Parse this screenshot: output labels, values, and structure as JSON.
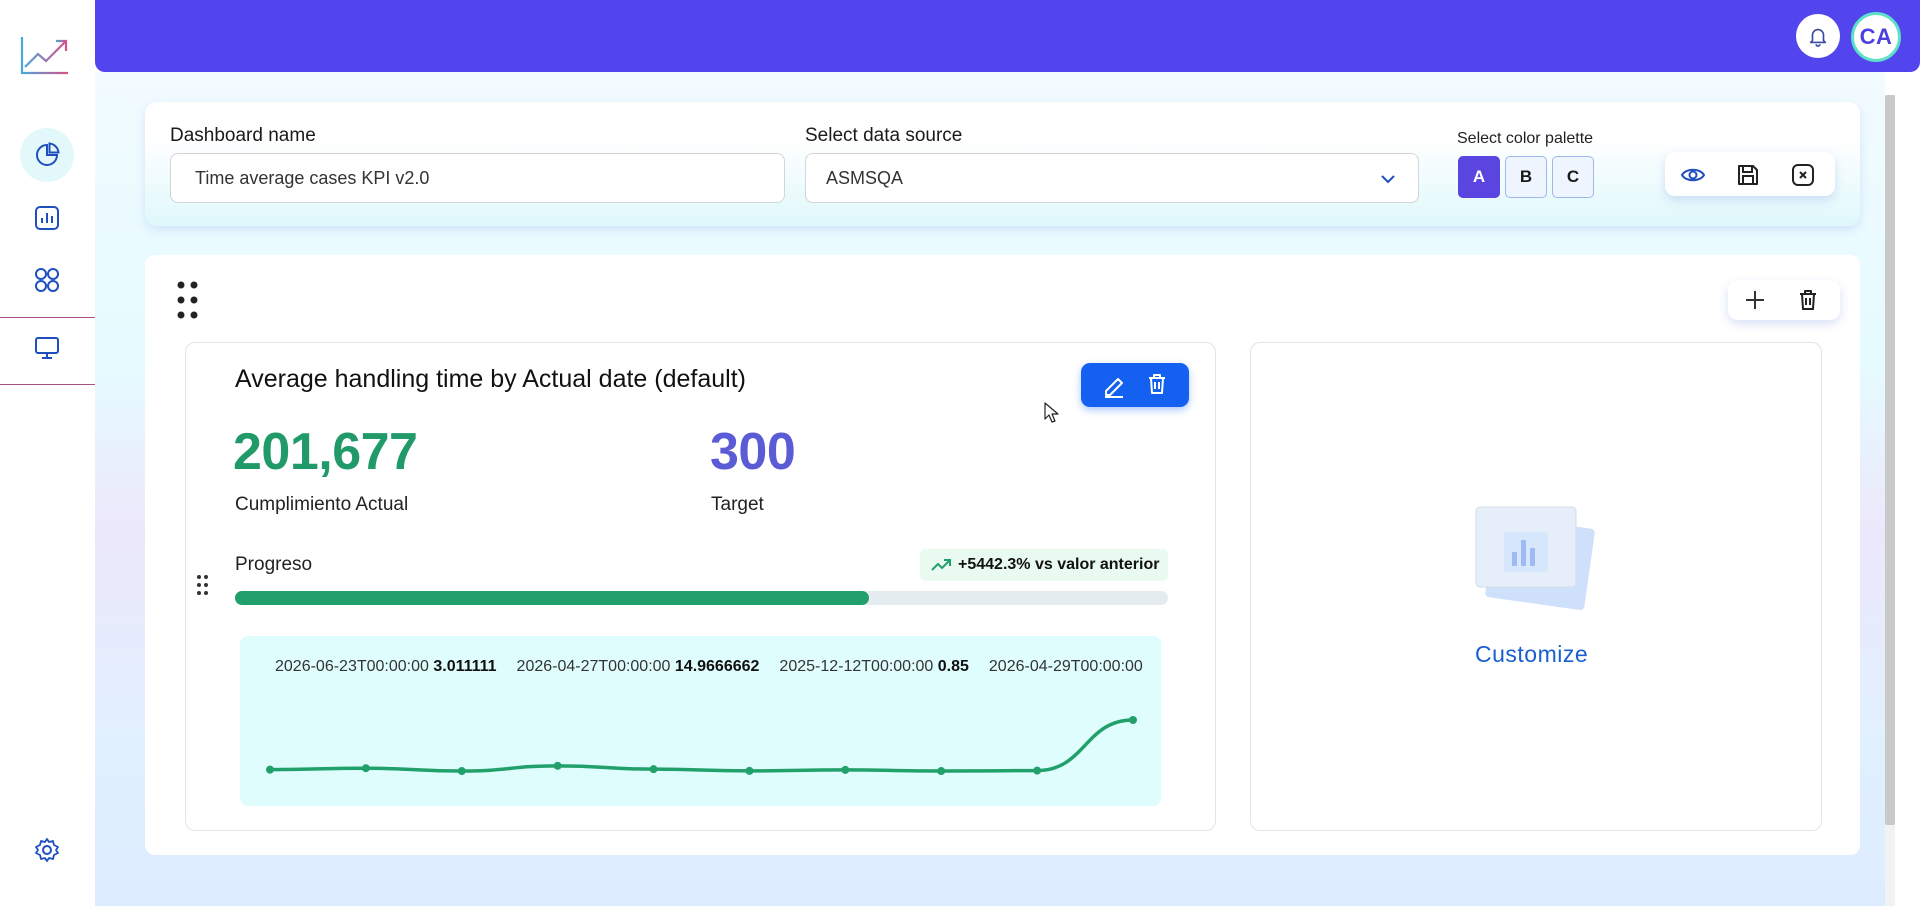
{
  "sidebar": {
    "items": [
      {
        "name": "dashboards",
        "icon": "pie-chart-icon",
        "active": true
      },
      {
        "name": "reports",
        "icon": "bar-chart-icon",
        "active": false
      },
      {
        "name": "apps",
        "icon": "grid-icon",
        "active": false
      },
      {
        "name": "screens",
        "icon": "monitor-icon",
        "active": false
      }
    ],
    "settings_icon": "gear-icon"
  },
  "topbar": {
    "avatar_initials": "CA",
    "notifications_icon": "bell-icon"
  },
  "header": {
    "dashboard_name_label": "Dashboard name",
    "dashboard_name_value": "Time average cases KPI v2.0",
    "data_source_label": "Select data source",
    "data_source_value": "ASMSQA",
    "palette_label": "Select color palette",
    "palettes": [
      "A",
      "B",
      "C"
    ],
    "selected_palette": "A"
  },
  "widget": {
    "title": "Average handling time by Actual date (default)",
    "actual_value": "201,677",
    "actual_label": "Cumplimiento Actual",
    "target_value": "300",
    "target_label": "Target",
    "progress_label": "Progreso",
    "progress_fraction": 0.68,
    "trend_text": "+5442.3% vs valor anterior",
    "spark_points": [
      {
        "date": "2026-06-23T00:00:00",
        "value": "3.011111"
      },
      {
        "date": "2026-04-27T00:00:00",
        "value": "14.9666662"
      },
      {
        "date": "2025-12-12T00:00:00",
        "value": "0.85"
      },
      {
        "date": "2026-04-29T00:00:00",
        "value": ""
      }
    ],
    "spark_series": [
      2.5,
      4.0,
      1.0,
      6.5,
      3.0,
      1.2,
      2.2,
      1.0,
      1.5,
      55.0
    ]
  },
  "placeholder": {
    "link_label": "Customize"
  },
  "colors": {
    "brand": "#5345ee",
    "positive": "#22a06b",
    "target": "#5b5bd6",
    "edit_blue": "#1460f0"
  }
}
